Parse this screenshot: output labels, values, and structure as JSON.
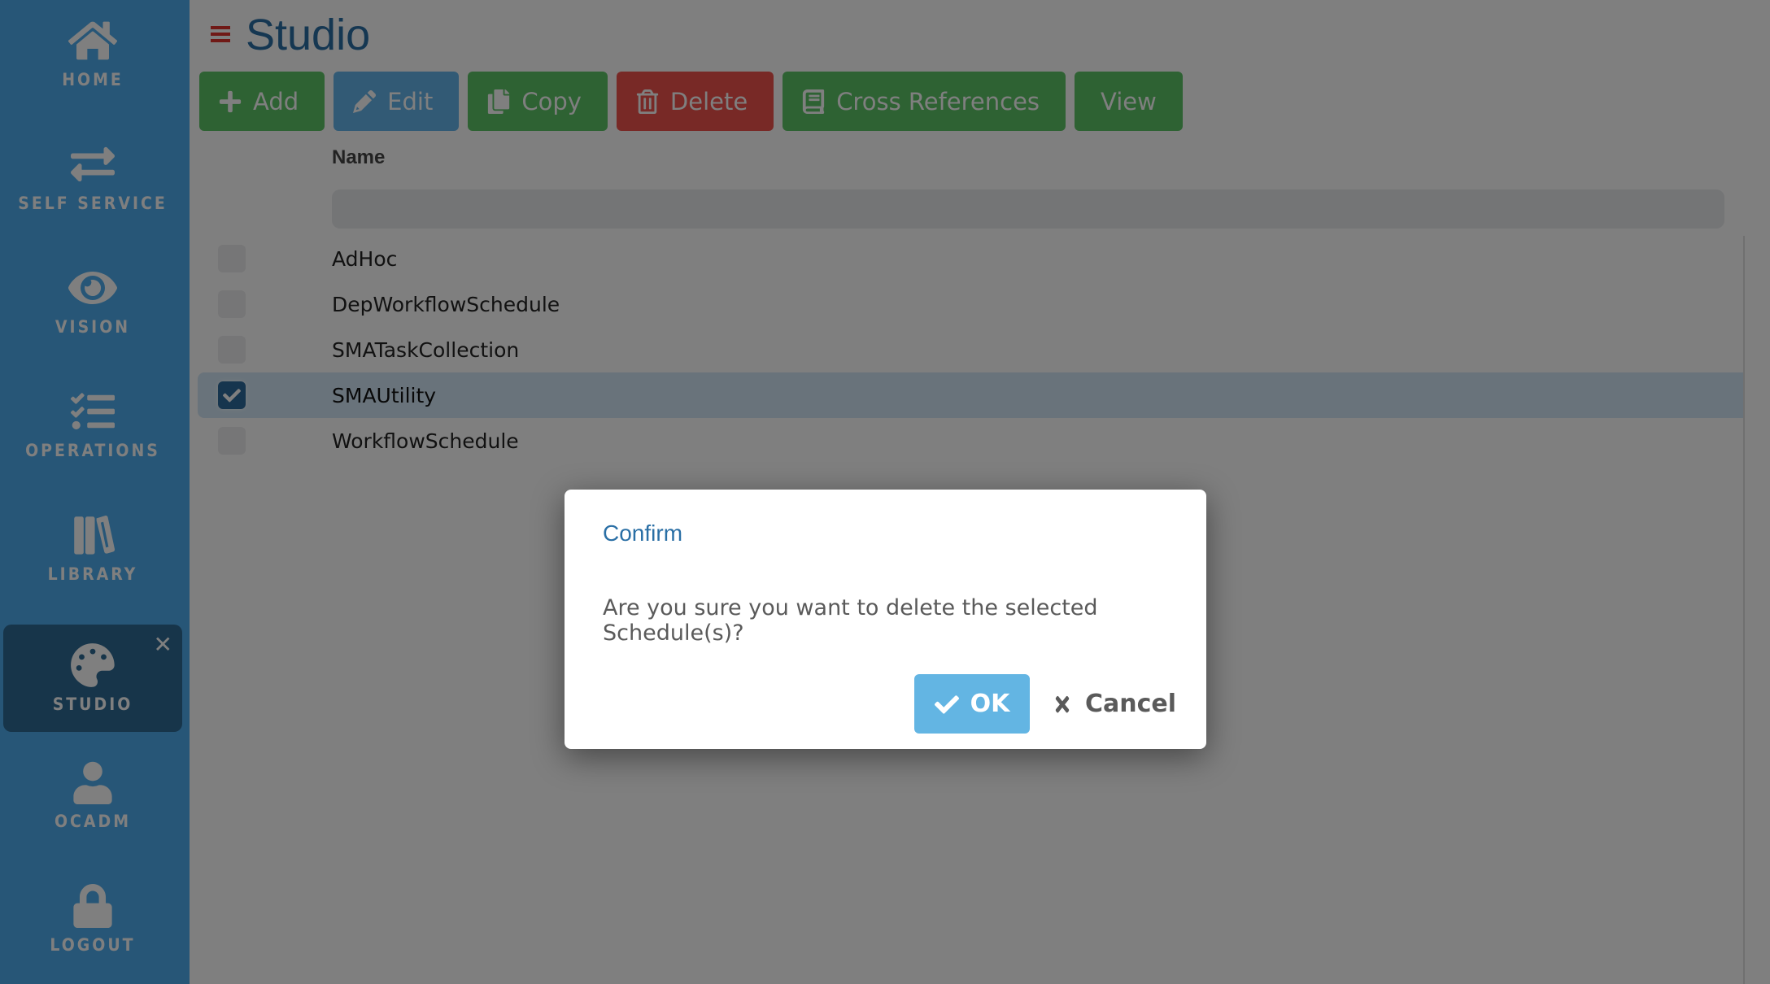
{
  "sidebar": {
    "items": [
      {
        "label": "HOME",
        "icon": "home-icon"
      },
      {
        "label": "SELF SERVICE",
        "icon": "exchange-arrows-icon"
      },
      {
        "label": "VISION",
        "icon": "eye-icon"
      },
      {
        "label": "OPERATIONS",
        "icon": "task-list-icon"
      },
      {
        "label": "LIBRARY",
        "icon": "books-icon"
      },
      {
        "label": "STUDIO",
        "icon": "palette-icon",
        "active": true,
        "close": "✕"
      },
      {
        "label": "OCADM",
        "icon": "user-icon"
      },
      {
        "label": "LOGOUT",
        "icon": "lock-icon"
      }
    ]
  },
  "header": {
    "menu_icon": "hamburger-icon",
    "title": "Studio"
  },
  "toolbar": {
    "add_label": "Add",
    "edit_label": "Edit",
    "copy_label": "Copy",
    "delete_label": "Delete",
    "cross_references_label": "Cross References",
    "view_label": "View"
  },
  "table": {
    "column_header": "Name",
    "filter_value": "",
    "rows": [
      {
        "name": "AdHoc",
        "checked": false
      },
      {
        "name": "DepWorkflowSchedule",
        "checked": false
      },
      {
        "name": "SMATaskCollection",
        "checked": false
      },
      {
        "name": "SMAUtility",
        "checked": true
      },
      {
        "name": "WorkflowSchedule",
        "checked": false
      }
    ]
  },
  "dialog": {
    "title": "Confirm",
    "message": "Are you sure you want to delete the selected Schedule(s)?",
    "ok_label": "OK",
    "cancel_label": "Cancel"
  },
  "colors": {
    "sidebar": "#4fadee",
    "sidebar_active": "#2f6b95",
    "green_button": "#5cc466",
    "blue_button": "#64b4ea",
    "red_button": "#f0524c",
    "ok_button": "#63b5e3",
    "title_blue": "#2a6fa5",
    "hamburger_red": "#e0322d"
  }
}
